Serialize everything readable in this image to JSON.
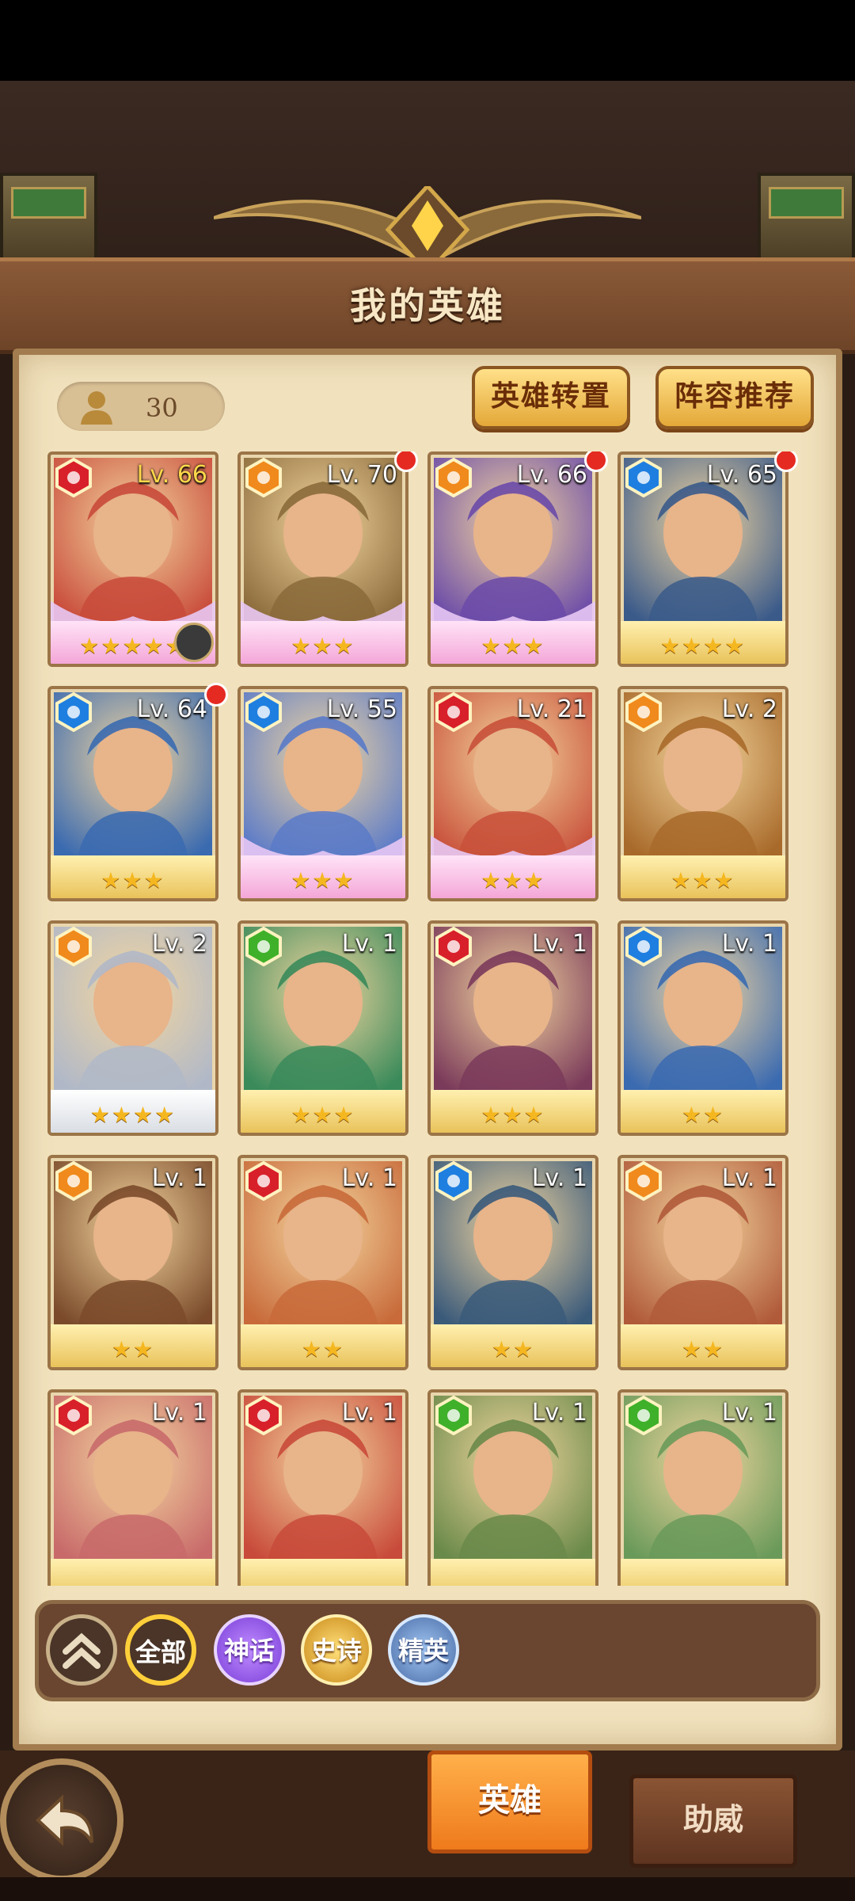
{
  "header": {
    "title": "我的英雄"
  },
  "hero_count": {
    "icon": "person-icon",
    "value": "30"
  },
  "top_buttons": {
    "hero_transfer": "英雄转置",
    "lineup_recommend": "阵容推荐"
  },
  "heroes": [
    {
      "level": "Lv. 66",
      "element": "fire",
      "stars": "★★★★★",
      "frame": "pink",
      "level_color": "gold",
      "red_dot": false,
      "timer": true
    },
    {
      "level": "Lv. 70",
      "element": "earth",
      "stars": "★★★",
      "frame": "pink",
      "red_dot": true
    },
    {
      "level": "Lv. 66",
      "element": "earth",
      "stars": "★★★",
      "frame": "pink",
      "red_dot": true
    },
    {
      "level": "Lv. 65",
      "element": "water",
      "stars": "★★★★",
      "frame": "gold",
      "red_dot": true
    },
    {
      "level": "Lv. 64",
      "element": "water",
      "stars": "★★★",
      "frame": "gold",
      "red_dot": true
    },
    {
      "level": "Lv. 55",
      "element": "water",
      "stars": "★★★",
      "frame": "pink",
      "red_dot": false
    },
    {
      "level": "Lv. 21",
      "element": "fire",
      "stars": "★★★",
      "frame": "pink",
      "red_dot": false
    },
    {
      "level": "Lv. 2",
      "element": "earth",
      "stars": "★★★",
      "frame": "gold",
      "red_dot": false
    },
    {
      "level": "Lv. 2",
      "element": "earth",
      "stars": "★★★★",
      "frame": "white",
      "red_dot": false
    },
    {
      "level": "Lv. 1",
      "element": "nature",
      "stars": "★★★",
      "frame": "gold",
      "red_dot": false
    },
    {
      "level": "Lv. 1",
      "element": "fire",
      "stars": "★★★",
      "frame": "gold",
      "red_dot": false
    },
    {
      "level": "Lv. 1",
      "element": "water",
      "stars": "★★",
      "frame": "gold",
      "red_dot": false
    },
    {
      "level": "Lv. 1",
      "element": "earth",
      "stars": "★★",
      "frame": "gold",
      "red_dot": false
    },
    {
      "level": "Lv. 1",
      "element": "fire",
      "stars": "★★",
      "frame": "gold",
      "red_dot": false
    },
    {
      "level": "Lv. 1",
      "element": "water",
      "stars": "★★",
      "frame": "gold",
      "red_dot": false
    },
    {
      "level": "Lv. 1",
      "element": "earth",
      "stars": "★★",
      "frame": "gold",
      "red_dot": false
    },
    {
      "level": "Lv. 1",
      "element": "fire",
      "stars": "",
      "frame": "gold",
      "red_dot": false
    },
    {
      "level": "Lv. 1",
      "element": "fire",
      "stars": "",
      "frame": "gold",
      "red_dot": false
    },
    {
      "level": "Lv. 1",
      "element": "nature",
      "stars": "",
      "frame": "gold",
      "red_dot": false
    },
    {
      "level": "Lv. 1",
      "element": "nature",
      "stars": "",
      "frame": "gold",
      "red_dot": false
    }
  ],
  "element_colors": {
    "fire": "#d8202a",
    "earth": "#f08a1c",
    "water": "#1f7fe0",
    "nature": "#3fb02a"
  },
  "filters": {
    "collapse_icon": "double-chevron-up-icon",
    "all": "全部",
    "mythic": "神话",
    "epic": "史诗",
    "elite": "精英"
  },
  "bottom_tabs": {
    "hero": "英雄",
    "assist": "助威",
    "back_icon": "back-arrow-icon"
  }
}
